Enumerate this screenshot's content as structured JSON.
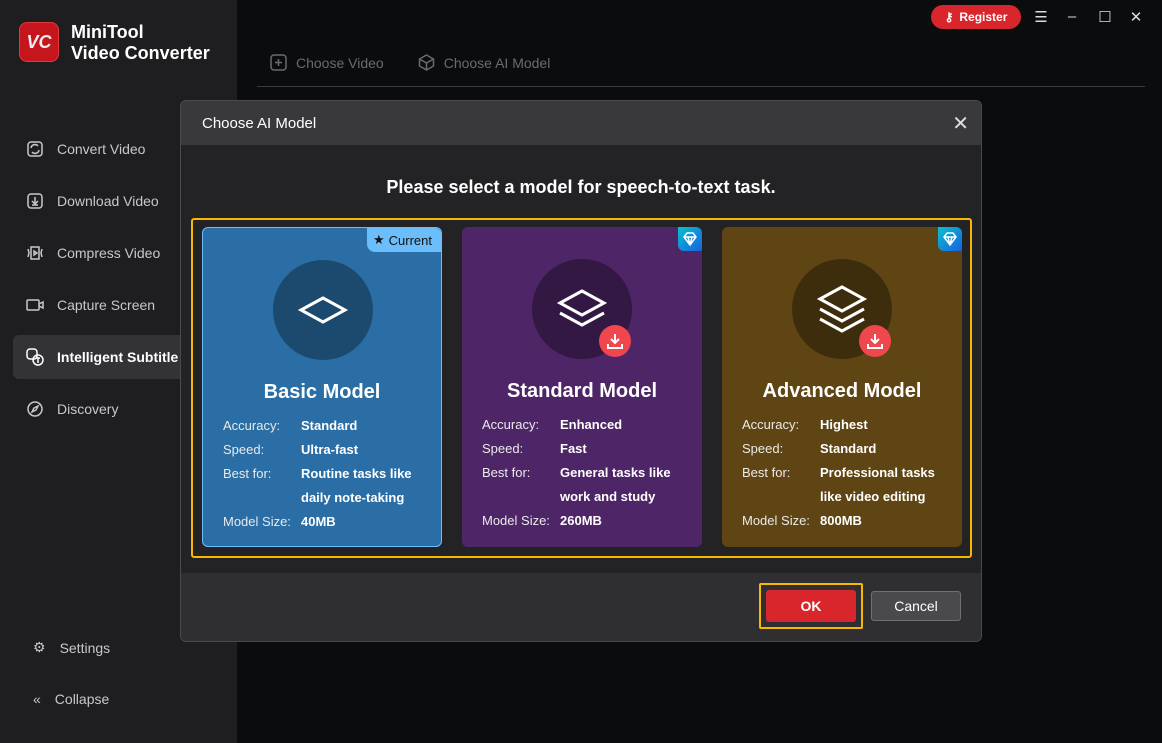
{
  "app": {
    "logo_text": "VC",
    "name_line1": "MiniTool",
    "name_line2": "Video Converter"
  },
  "sidebar": {
    "items": [
      {
        "label": "Convert Video",
        "icon": "convert-icon"
      },
      {
        "label": "Download Video",
        "icon": "download-icon"
      },
      {
        "label": "Compress Video",
        "icon": "compress-icon"
      },
      {
        "label": "Capture Screen",
        "icon": "camera-icon"
      },
      {
        "label": "Intelligent Subtitle",
        "icon": "subtitle-icon",
        "active": true
      },
      {
        "label": "Discovery",
        "icon": "compass-icon"
      }
    ],
    "settings": "Settings",
    "collapse": "Collapse"
  },
  "topbar": {
    "register": "Register"
  },
  "steps": [
    "Choose Video",
    "Choose AI Model"
  ],
  "dialog": {
    "title": "Choose AI Model",
    "prompt": "Please select a model for speech-to-text task.",
    "labels": {
      "accuracy": "Accuracy:",
      "speed": "Speed:",
      "best_for": "Best for:",
      "size": "Model Size:"
    },
    "current_badge": "Current",
    "models": [
      {
        "name": "Basic Model",
        "accuracy": "Standard",
        "speed": "Ultra-fast",
        "best_for_1": "Routine tasks like",
        "best_for_2": "daily note-taking",
        "size": "40MB",
        "color": "#2a6ea5"
      },
      {
        "name": "Standard Model",
        "accuracy": "Enhanced",
        "speed": "Fast",
        "best_for_1": "General tasks like",
        "best_for_2": "work and study",
        "size": "260MB",
        "color": "#4e2667"
      },
      {
        "name": "Advanced Model",
        "accuracy": "Highest",
        "speed": "Standard",
        "best_for_1": "Professional tasks",
        "best_for_2": "like video editing",
        "size": "800MB",
        "color": "#5f4514"
      }
    ],
    "ok": "OK",
    "cancel": "Cancel"
  }
}
